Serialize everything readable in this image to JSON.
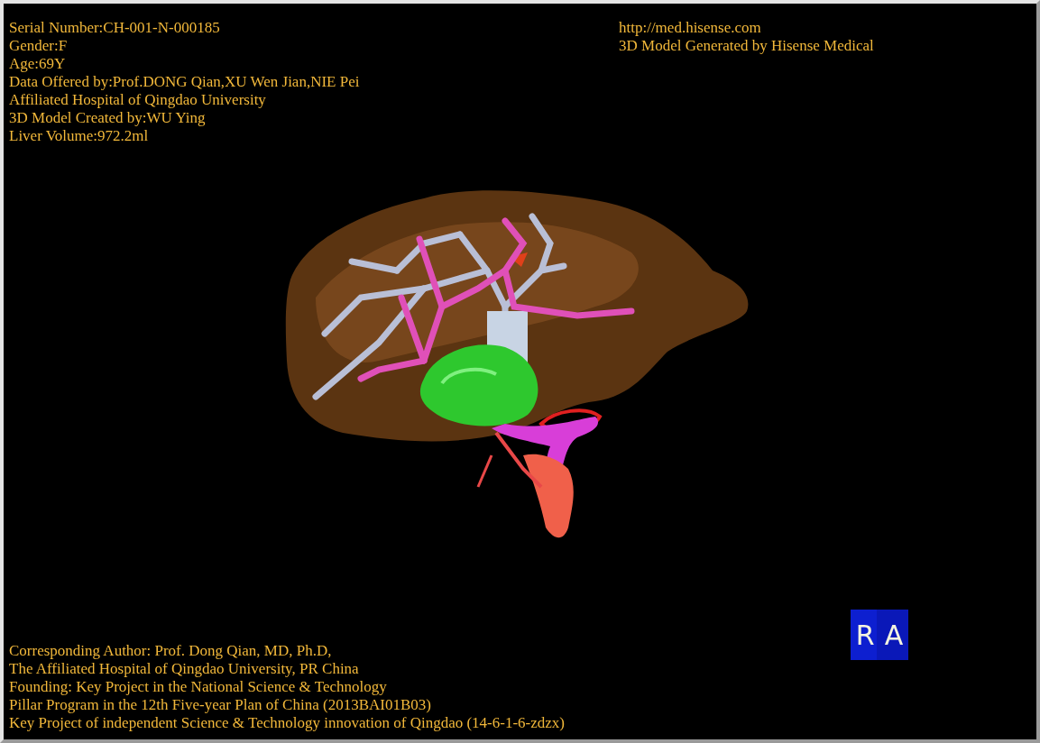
{
  "patient_info": [
    "Serial Number:CH-001-N-000185",
    "Gender:F",
    "Age:69Y",
    "Data Offered by:Prof.DONG Qian,XU Wen Jian,NIE Pei",
    "Affiliated Hospital of Qingdao University",
    "3D Model Created by:WU Ying",
    "Liver Volume:972.2ml"
  ],
  "source_info": [
    "http://med.hisense.com",
    "3D Model Generated by Hisense Medical"
  ],
  "credits": [
    "Corresponding Author: Prof. Dong Qian, MD, Ph.D,",
    "The Affiliated Hospital of Qingdao University, PR China",
    "Founding: Key Project in the National Science & Technology",
    "Pillar Program in the 12th Five-year Plan of China (2013BAI01B03)",
    "Key Project of independent Science & Technology innovation of Qingdao (14-6-1-6-zdzx)"
  ],
  "orientation_cube": {
    "labels": [
      "R",
      "A"
    ]
  }
}
